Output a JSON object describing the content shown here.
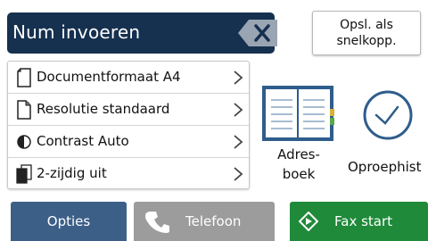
{
  "number_input": {
    "placeholder": "Num invoeren",
    "backspace_icon": "backspace-icon"
  },
  "shortcut_button": {
    "line1": "Opsl. als",
    "line2": "snelkopp."
  },
  "settings": [
    {
      "label": "Documentformaat A4",
      "icon": "document-size-icon"
    },
    {
      "label": "Resolutie standaard",
      "icon": "resolution-icon"
    },
    {
      "label": "Contrast Auto",
      "icon": "contrast-icon"
    },
    {
      "label": "2-zijdig uit",
      "icon": "two-sided-icon"
    }
  ],
  "address_book": {
    "line1": "Adres-",
    "line2": "boek",
    "icon": "address-book-icon"
  },
  "call_history": {
    "label": "Oproephist",
    "icon": "clock-icon"
  },
  "bottom_bar": {
    "options_label": "Opties",
    "phone_label": "Telefoon",
    "fax_start_label": "Fax start"
  },
  "colors": {
    "input_bg": "#16304f",
    "options_bg": "#3c5f88",
    "phone_bg": "#9c9c9c",
    "fax_bg": "#1f8a3a",
    "book_accent": "#2f5d8c",
    "book_tab": "#d7b23a"
  }
}
